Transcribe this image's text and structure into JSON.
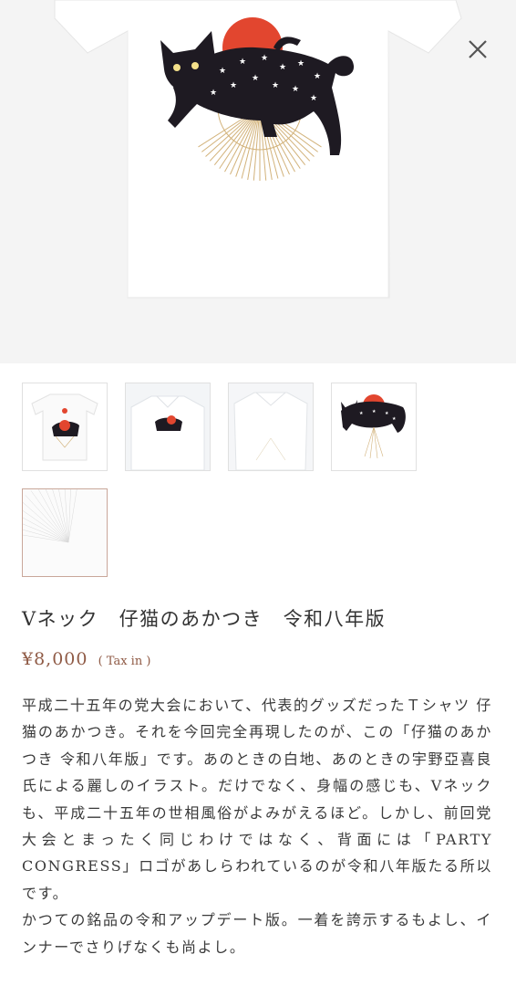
{
  "product": {
    "title": "Vネック　仔猫のあかつき　令和八年版",
    "price": "¥8,000",
    "tax_note": "( Tax in )",
    "description": [
      "平成二十五年の党大会において、代表的グッズだったＴシャツ 仔猫のあかつき。それを今回完全再現したのが、この「仔猫のあかつき 令和八年版」です。あのときの白地、あのときの宇野亞喜良氏による麗しのイラスト。だけでなく、身幅の感じも、Vネックも、平成二十五年の世相風俗がよみがえるほど。しかし、前回党大会とまったく同じわけではなく、背面には「PARTY CONGRESS」ロゴがあしらわれているのが令和八年版たる所以です。",
      "かつての銘品の令和アップデート版。一着を誇示するもよし、インナーでさりげなくも尚よし。"
    ]
  },
  "gallery": {
    "main_image": "white t-shirt with black cat, red sun and gold rays illustration",
    "thumbnails": [
      {
        "subject": "front of white t-shirt with cat illustration"
      },
      {
        "subject": "t-shirt worn, front view"
      },
      {
        "subject": "back of t-shirt"
      },
      {
        "subject": "close-up of cat illustration"
      },
      {
        "subject": "close-up of gold ray lines",
        "selected": true
      }
    ]
  },
  "icons": {
    "close": "close-icon"
  },
  "colors": {
    "accent": "#8f5a45",
    "sun": "#e2462f",
    "rays": "#d2b27a",
    "background": "#f4f4f4"
  }
}
